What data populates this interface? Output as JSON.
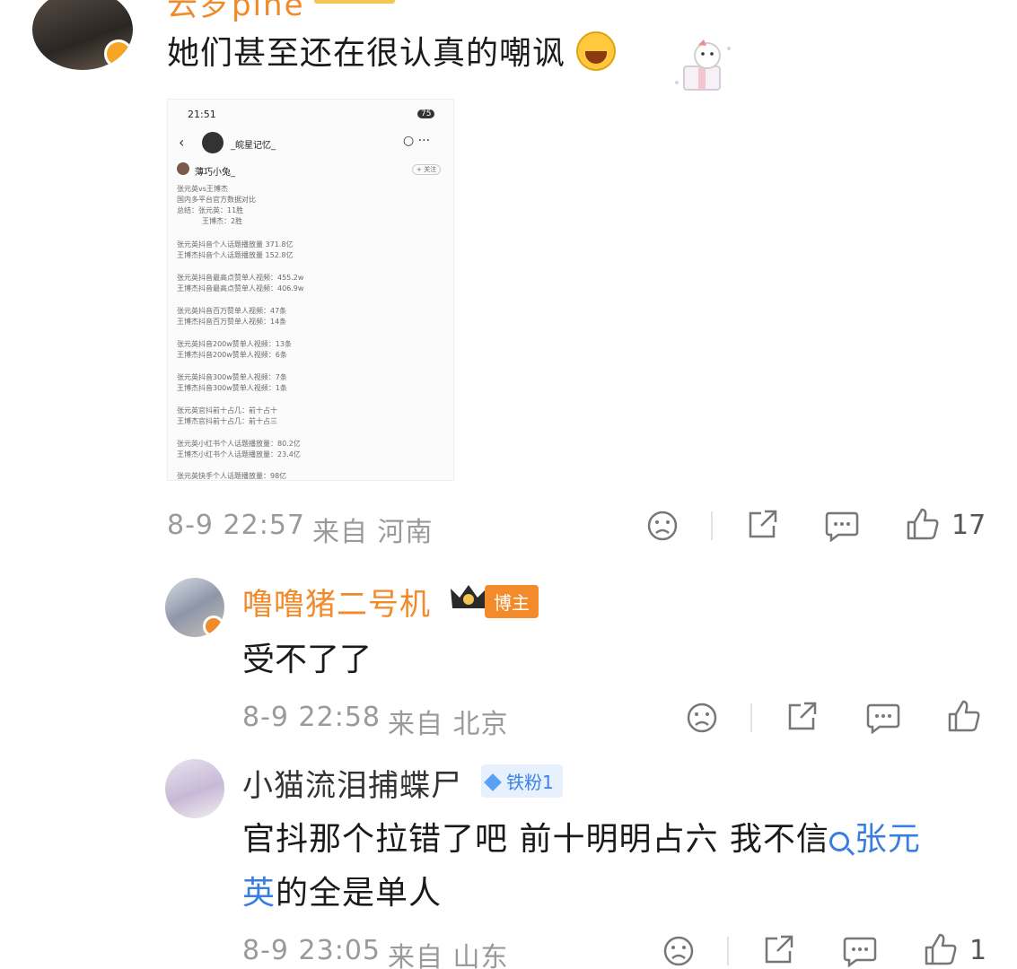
{
  "comments": [
    {
      "username": "云岁pine",
      "text": "她们甚至还在很认真的嘲讽",
      "date": "8-9 22:57",
      "location": "来自 河南",
      "likes": "17",
      "screenshot": {
        "time": "21:51",
        "battery": "75",
        "account": "_皖星记忆_",
        "author": "薄巧小兔_",
        "follow": "+ 关注",
        "lines": [
          "张元英vs王博杰",
          "国内多平台官方数据对比",
          "总结：张元英：11胜",
          "王博杰：2胜",
          "张元英抖音个人话题播放量 371.8亿",
          "王博杰抖音个人话题播放量 152.8亿",
          "张元英抖音最高点赞单人视频：455.2w",
          "王博杰抖音最高点赞单人视频：406.9w",
          "张元英抖音百万赞单人视频：47条",
          "王博杰抖音百万赞单人视频：14条",
          "张元英抖音200w赞单人视频：13条",
          "王博杰抖音200w赞单人视频：6条",
          "张元英抖音300w赞单人视频：7条",
          "王博杰抖音300w赞单人视频：1条",
          "张元英官抖前十占几：前十占十",
          "王博杰官抖前十占几：前十占三",
          "张元英小红书个人话题播放量：80.2亿",
          "王博杰小红书个人话题播放量：23.4亿",
          "张元英快手个人话题播放量：98亿"
        ]
      }
    },
    {
      "username": "噜噜猪二号机",
      "tag": "博主",
      "text": "受不了了",
      "date": "8-9 22:58",
      "location": "来自 北京"
    },
    {
      "username": "小猫流泪捕蝶尸",
      "tag": "铁粉1",
      "text_line1": "官抖那个拉错了吧 前十明明占六 我不信",
      "link_part1": "张元",
      "link_part2": "英",
      "text_line2_rest": "的全是单人",
      "date": "8-9 23:05",
      "location": "来自 山东",
      "likes": "1"
    }
  ],
  "colors": {
    "username_orange": "#f08a2a",
    "link_blue": "#3b7ddd",
    "meta_gray": "#9a9a9a",
    "fan_tag_blue": "#3a82e8"
  },
  "icons": [
    "dislike-face-icon",
    "share-icon",
    "comment-icon",
    "like-thumb-icon"
  ]
}
